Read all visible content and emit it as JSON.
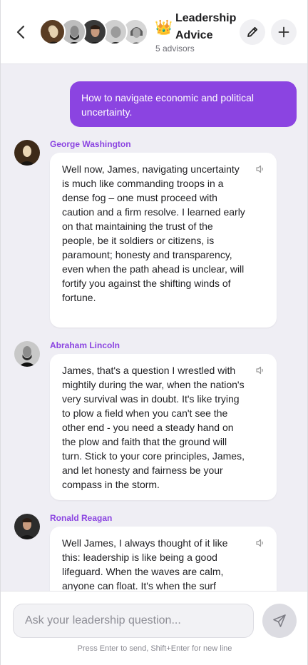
{
  "header": {
    "back_icon": "chevron-left-icon",
    "crown_emoji": "👑",
    "title": "Leadership Advice",
    "subtitle": "5 advisors",
    "edit_icon": "pencil-icon",
    "add_icon": "plus-icon",
    "advisor_avatars": [
      "George Washington",
      "Abraham Lincoln",
      "Ronald Reagan",
      "Winston Churchill",
      "Margaret Thatcher"
    ]
  },
  "chat": {
    "user_message": "How to navigate economic and political uncertainty.",
    "messages": [
      {
        "name": "George Washington",
        "text": "Well now, James, navigating uncertainty is much like commanding troops in a dense fog – one must proceed with caution and a firm resolve. I learned early on that maintaining the trust of the people, be it soldiers or citizens, is paramount; honesty and transparency, even when the path ahead is unclear, will fortify you against the shifting winds of fortune."
      },
      {
        "name": "Abraham Lincoln",
        "text": "James, that's a question I wrestled with mightily during the war, when the nation's very survival was in doubt. It's like trying to plow a field when you can't see the other end - you need a steady hand on the plow and faith that the ground will turn. Stick to your core principles, James, and let honesty and fairness be your compass in the storm."
      },
      {
        "name": "Ronald Reagan",
        "text": "Well James, I always thought of it like this: leadership is like being a good lifeguard. When the waves are calm, anyone can float. It's when the surf"
      }
    ]
  },
  "footer": {
    "placeholder": "Ask your leadership question...",
    "send_icon": "send-icon",
    "hint": "Press Enter to send, Shift+Enter for new line"
  },
  "colors": {
    "accent": "#8b44e1",
    "background": "#efeef4",
    "bubble": "#ffffff"
  }
}
